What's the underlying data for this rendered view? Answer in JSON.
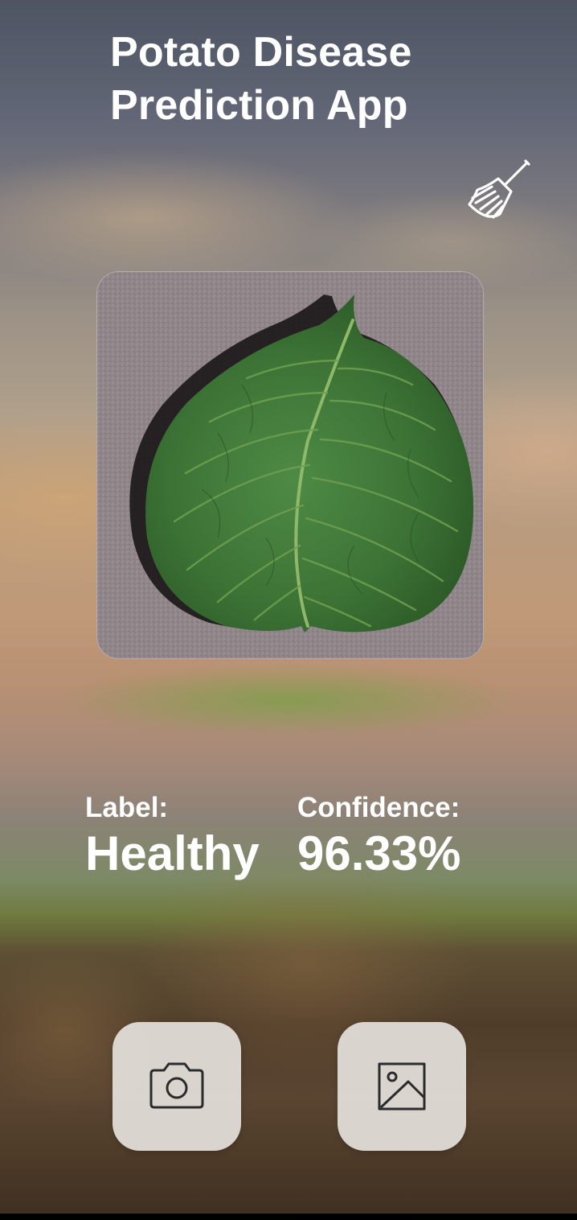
{
  "app": {
    "title_line1": "Potato Disease",
    "title_line2": "Prediction App"
  },
  "toolbar": {
    "clear_icon": "broom-icon"
  },
  "preview": {
    "image_subject": "potato leaf",
    "alt": "Potato leaf"
  },
  "result": {
    "label_caption": "Label:",
    "label_value": "Healthy",
    "confidence_caption": "Confidence:",
    "confidence_value": "96.33%"
  },
  "actions": {
    "camera_icon": "camera-icon",
    "gallery_icon": "image-gallery-icon"
  },
  "colors": {
    "text": "#ffffff",
    "button_bg": "#e8e4e0",
    "icon_stroke": "#2b2b2b",
    "leaf": "#3f7a3a"
  }
}
